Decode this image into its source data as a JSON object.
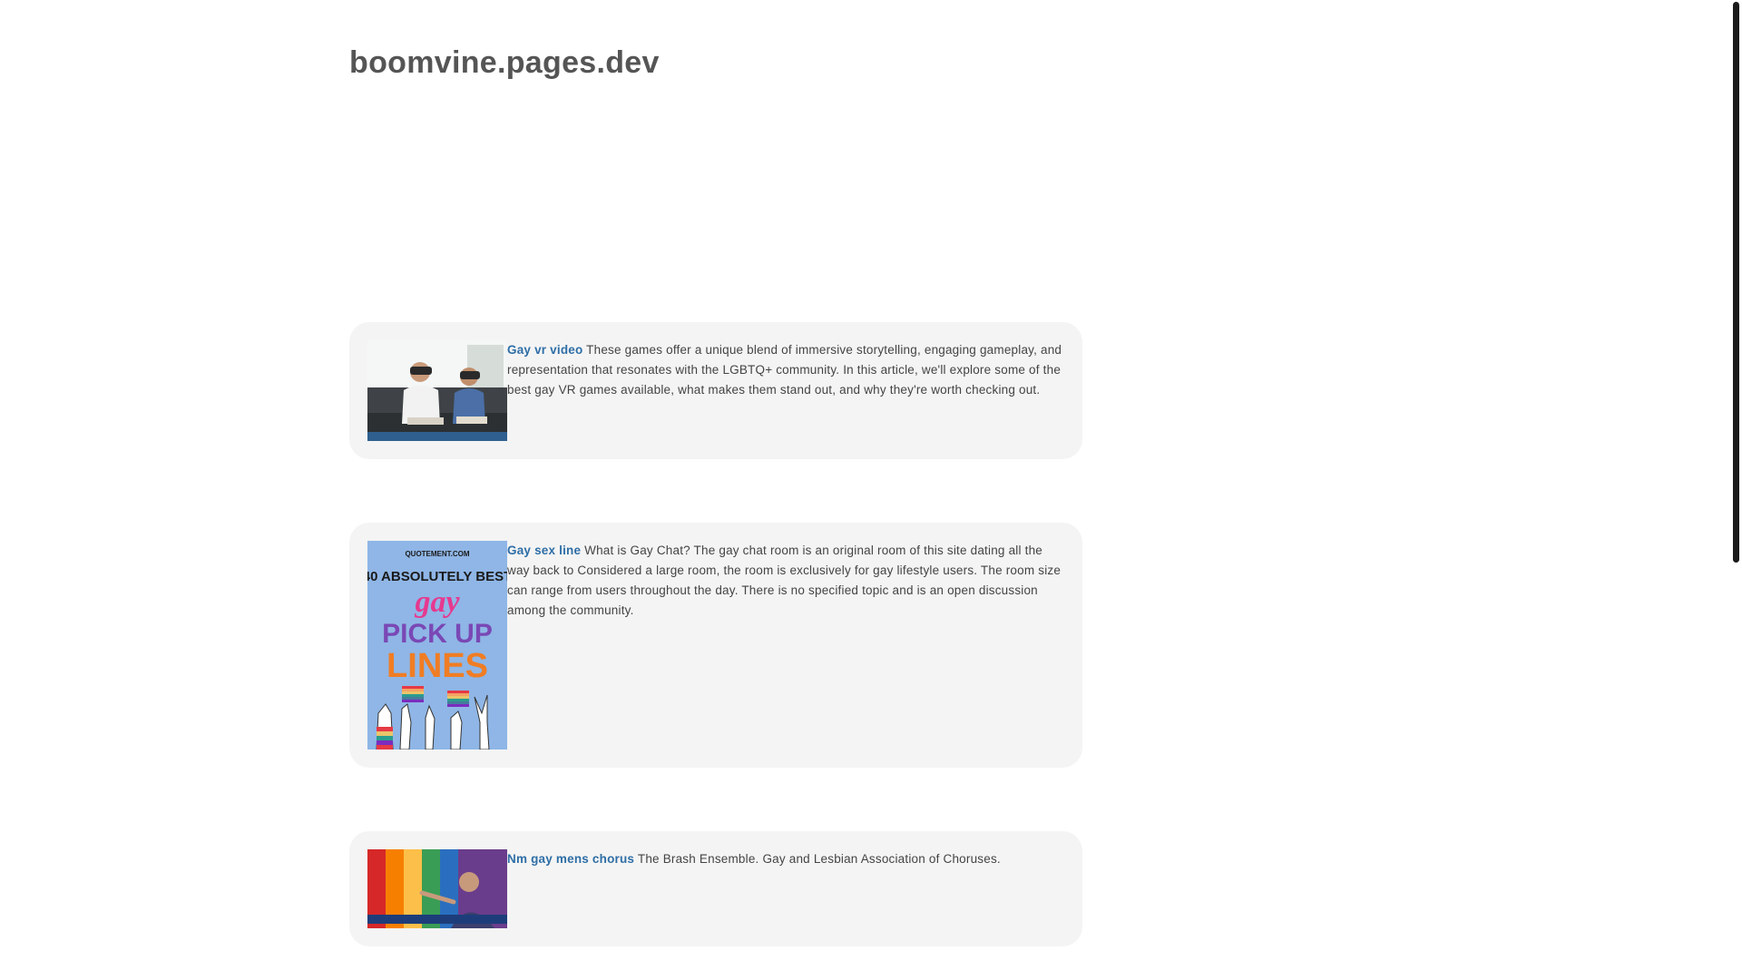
{
  "site": {
    "title": "boomvine.pages.dev"
  },
  "posts": [
    {
      "title": "Gay vr video",
      "excerpt": "These games offer a unique blend of immersive storytelling, engaging gameplay, and representation that resonates with the LGBTQ+ community. In this article, we'll explore some of the best gay VR games available, what makes them stand out, and why they're worth checking out."
    },
    {
      "title": "Gay sex line",
      "excerpt": "What is Gay Chat? The gay chat room is an original room of this site dating all the way back to Considered a large room, the room is exclusively for gay lifestyle users. The room size can range from users throughout the day. There is no specified topic and is an open discussion among the community.",
      "thumbnail": {
        "site": "QUOTEMENT.COM",
        "line1": "40 ABSOLUTELY BEST",
        "line2": "gay",
        "line3": "PICK UP",
        "line4": "LINES"
      }
    },
    {
      "title": "Nm gay mens chorus",
      "excerpt": "The Brash Ensemble. Gay and Lesbian Association of Choruses."
    }
  ],
  "colors": {
    "link": "#2e6ea6",
    "card_bg": "#f4f4f4",
    "title": "#555555"
  }
}
